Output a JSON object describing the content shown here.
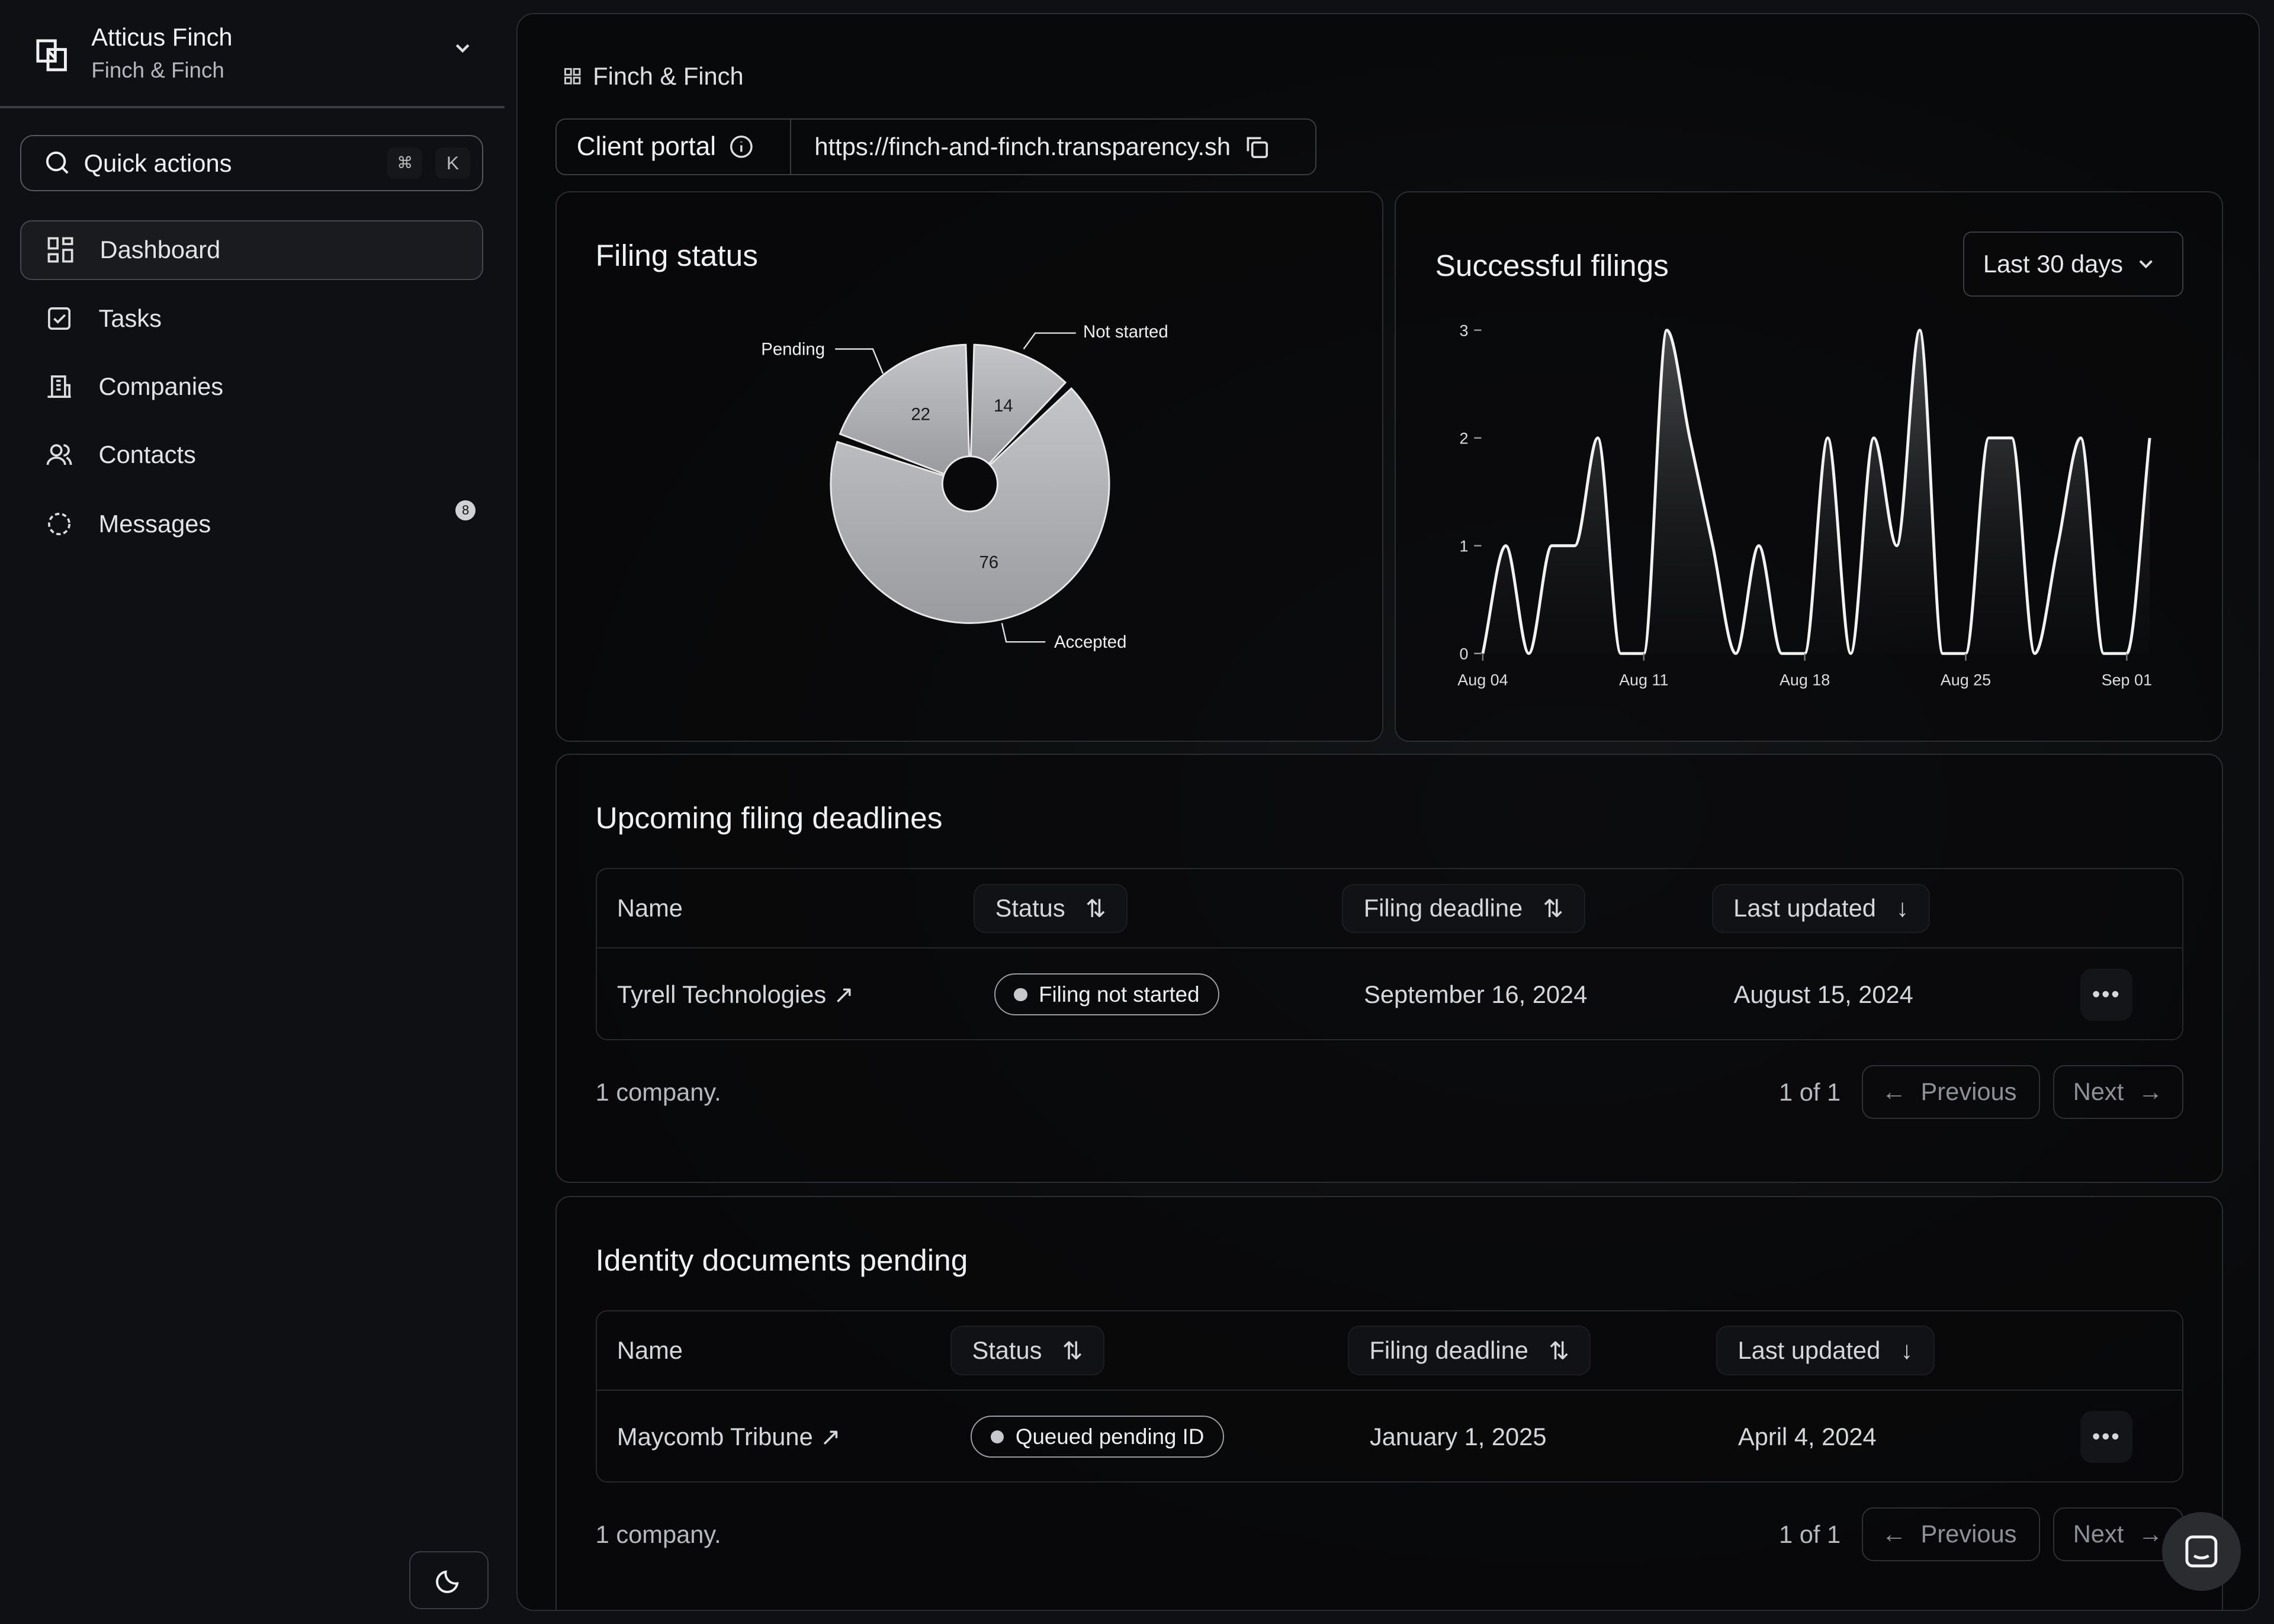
{
  "sidebar": {
    "user_name": "Atticus Finch",
    "org_name": "Finch & Finch",
    "quick_actions": {
      "label": "Quick actions",
      "kbd_mod": "⌘",
      "kbd_key": "K"
    },
    "items": [
      {
        "label": "Dashboard",
        "icon": "grid-icon",
        "active": true
      },
      {
        "label": "Tasks",
        "icon": "checkbox-icon"
      },
      {
        "label": "Companies",
        "icon": "building-icon"
      },
      {
        "label": "Contacts",
        "icon": "users-icon"
      },
      {
        "label": "Messages",
        "icon": "message-icon",
        "badge": "8"
      }
    ]
  },
  "breadcrumb": "Finch & Finch",
  "client_portal": {
    "label": "Client portal",
    "url": "https://finch-and-finch.transparency.sh"
  },
  "filing_status": {
    "title": "Filing status"
  },
  "successful_filings": {
    "title": "Successful filings",
    "range": "Last 30 days"
  },
  "chart_data": [
    {
      "type": "pie",
      "title": "Filing status",
      "donut": true,
      "categories": [
        "Not started",
        "Accepted",
        "Pending"
      ],
      "values": [
        14,
        76,
        22
      ]
    },
    {
      "type": "area",
      "title": "Successful filings",
      "x": [
        "Aug 04",
        "Aug 05",
        "Aug 06",
        "Aug 07",
        "Aug 08",
        "Aug 09",
        "Aug 10",
        "Aug 11",
        "Aug 12",
        "Aug 13",
        "Aug 14",
        "Aug 15",
        "Aug 16",
        "Aug 17",
        "Aug 18",
        "Aug 19",
        "Aug 20",
        "Aug 21",
        "Aug 22",
        "Aug 23",
        "Aug 24",
        "Aug 25",
        "Aug 26",
        "Aug 27",
        "Aug 28",
        "Aug 29",
        "Aug 30",
        "Aug 31",
        "Sep 01",
        "Sep 02"
      ],
      "values": [
        0,
        1,
        0,
        1,
        1,
        2,
        0,
        0,
        3,
        2,
        1,
        0,
        1,
        0,
        0,
        2,
        0,
        2,
        1,
        3,
        0,
        0,
        2,
        2,
        0,
        1,
        2,
        0,
        0,
        2
      ],
      "x_ticks": [
        "Aug 04",
        "Aug 11",
        "Aug 18",
        "Aug 25",
        "Sep 01"
      ],
      "y_ticks": [
        "0",
        "1",
        "2",
        "3"
      ],
      "ylim": [
        0,
        3
      ],
      "grid": false
    }
  ],
  "deadlines": {
    "title": "Upcoming filing deadlines",
    "columns": [
      "Name",
      "Status",
      "Filing deadline",
      "Last updated"
    ],
    "rows": [
      {
        "name": "Tyrell Technologies",
        "status": "Filing not started",
        "deadline": "September 16, 2024",
        "updated": "August 15, 2024"
      }
    ],
    "count": "1 company.",
    "page": "1 of 1",
    "prev": "Previous",
    "next": "Next"
  },
  "identity": {
    "title": "Identity documents pending",
    "columns": [
      "Name",
      "Status",
      "Filing deadline",
      "Last updated"
    ],
    "rows": [
      {
        "name": "Maycomb Tribune",
        "status": "Queued pending ID",
        "deadline": "January 1, 2025",
        "updated": "April 4, 2024"
      }
    ],
    "count": "1 company.",
    "page": "1 of 1",
    "prev": "Previous",
    "next": "Next"
  }
}
